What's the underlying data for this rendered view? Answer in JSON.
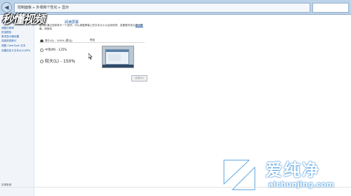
{
  "toolbar": {
    "back_glyph": "◀",
    "breadcrumb": [
      "控制面板",
      "外观和个性化",
      "显示"
    ]
  },
  "sidebar": {
    "items": [
      {
        "label": "控制面板主页"
      },
      {
        "label": "调整分辨率"
      },
      {
        "label": "校准颜色"
      },
      {
        "label": "更改显示器设置"
      },
      {
        "label": "连接到投影仪"
      },
      {
        "label": "调整 ClearType 文本"
      },
      {
        "label": "设置自定义文本大小(DPI)"
      }
    ],
    "see_also": "另请参阅"
  },
  "logo": {
    "text": "秒懂视频"
  },
  "content": {
    "heading": "阅读屏幕",
    "description": "您可以通过选择其中一个选项，可以调整屏幕上的文本大小以及其他项。若要暂时放大部分屏幕，请使用",
    "description_link": "放大镜",
    "options": [
      {
        "label": "较小(S) - 100% (默认)",
        "selected": true
      },
      {
        "label": "中等(M) - 125%",
        "selected": false
      },
      {
        "label": "较大(L) - 150%",
        "selected": false
      }
    ],
    "preview_label": "预览",
    "apply_label": "应用(A)"
  },
  "watermark": {
    "text": "爱纯净",
    "url": "aichunjing.com"
  },
  "colors": {
    "accent": "#1e5aa8",
    "titlebar": "#bcd3e9",
    "watermark_blue": "#1a7fd4"
  }
}
